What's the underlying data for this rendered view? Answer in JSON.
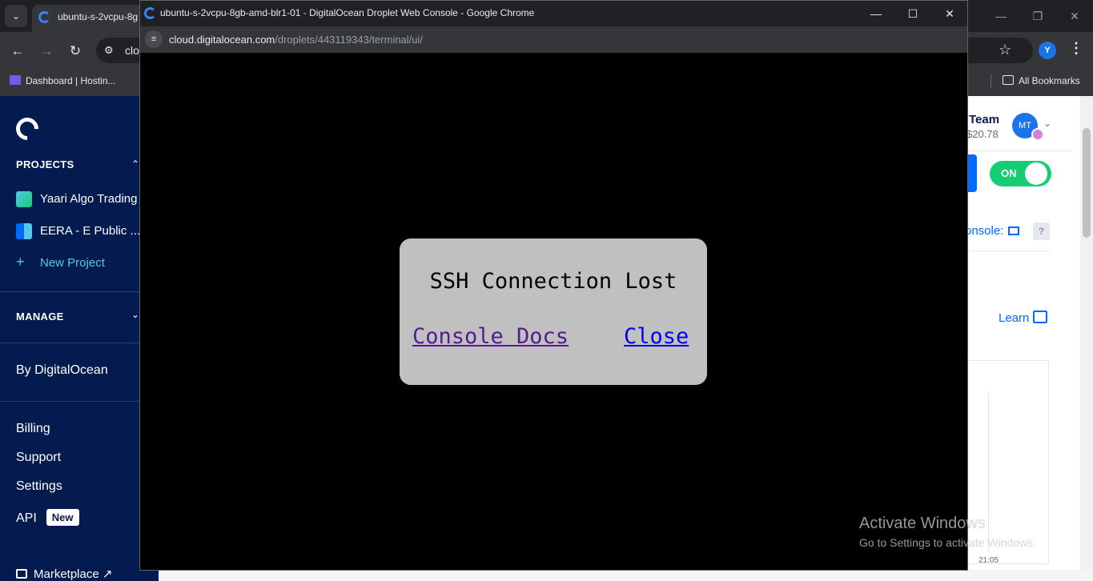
{
  "background_browser": {
    "tab_title": "ubuntu-s-2vcpu-8g",
    "omnibox_text": "clo",
    "profile_initial": "Y",
    "bookmarks": [
      {
        "label": "Dashboard | Hostin..."
      },
      {
        "label": "All Bookmarks"
      }
    ]
  },
  "sidebar": {
    "projects_heading": "PROJECTS",
    "projects": [
      {
        "name": "Yaari Algo Trading"
      },
      {
        "name": "EERA - E Public ..."
      }
    ],
    "new_project_label": "New Project",
    "manage_heading": "MANAGE",
    "by_digitalocean_label": "By DigitalOcean",
    "billing_label": "Billing",
    "support_label": "Support",
    "settings_label": "Settings",
    "api_label": "API",
    "api_badge": "New",
    "marketplace_label": "Marketplace ↗"
  },
  "account": {
    "team_name": "Team",
    "balance": "$20.78",
    "avatar_initials": "MT"
  },
  "droplet_panel": {
    "toggle_label": "ON",
    "console_label": "onsole:",
    "help_label": "?",
    "learn_label": "Learn",
    "graph_time_label": "21:05"
  },
  "popup": {
    "window_title": "ubuntu-s-2vcpu-8gb-amd-blr1-01 - DigitalOcean Droplet Web Console - Google Chrome",
    "url_host": "cloud.digitalocean.com",
    "url_path": "/droplets/443119343/terminal/ui/",
    "minimize_glyph": "—",
    "maximize_glyph": "☐",
    "close_glyph": "✕"
  },
  "dialog": {
    "title": "SSH Connection Lost",
    "docs_link": "Console Docs",
    "close_link": "Close"
  },
  "watermark": {
    "title": "Activate Windows",
    "subtitle": "Go to Settings to activate Windows."
  },
  "colors": {
    "sidebar_bg": "#031b4e",
    "accent_blue": "#0069ff",
    "toggle_green": "#15cd72",
    "new_project_cyan": "#54c7ec",
    "dialog_bg": "#c0c0c0"
  }
}
